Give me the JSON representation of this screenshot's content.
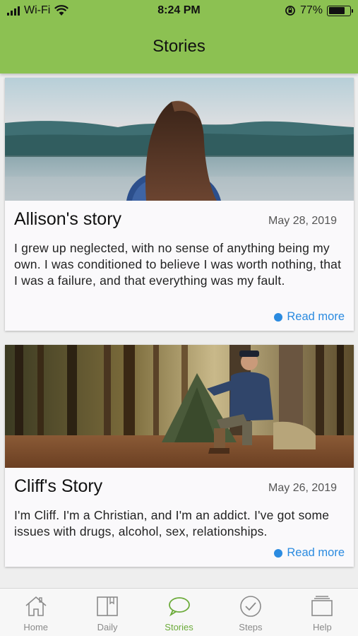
{
  "status_bar": {
    "carrier": "Wi-Fi",
    "time": "8:24 PM",
    "battery": "77%",
    "battery_level": 0.77
  },
  "header": {
    "title": "Stories"
  },
  "stories": [
    {
      "title": "Allison's story",
      "date": "May 28, 2019",
      "excerpt": "I grew up neglected, with no sense of anything being my own. I was conditioned to believe I was worth nothing, that I was a failure, and that everything was my fault.",
      "read_more": "Read more"
    },
    {
      "title": "Cliff's Story",
      "date": "May 26, 2019",
      "excerpt": "I'm Cliff. I'm a Christian, and I'm an addict. I've  got some issues with drugs, alcohol, sex, relationships.",
      "read_more": "Read more"
    }
  ],
  "tabs": [
    {
      "label": "Home",
      "icon": "home-icon"
    },
    {
      "label": "Daily",
      "icon": "book-icon"
    },
    {
      "label": "Stories",
      "icon": "chat-bubble-icon",
      "active": true
    },
    {
      "label": "Steps",
      "icon": "check-circle-icon"
    },
    {
      "label": "Help",
      "icon": "stack-icon"
    }
  ],
  "colors": {
    "header": "#8cc152",
    "accent": "#6cab3a",
    "link": "#2b8be0"
  }
}
